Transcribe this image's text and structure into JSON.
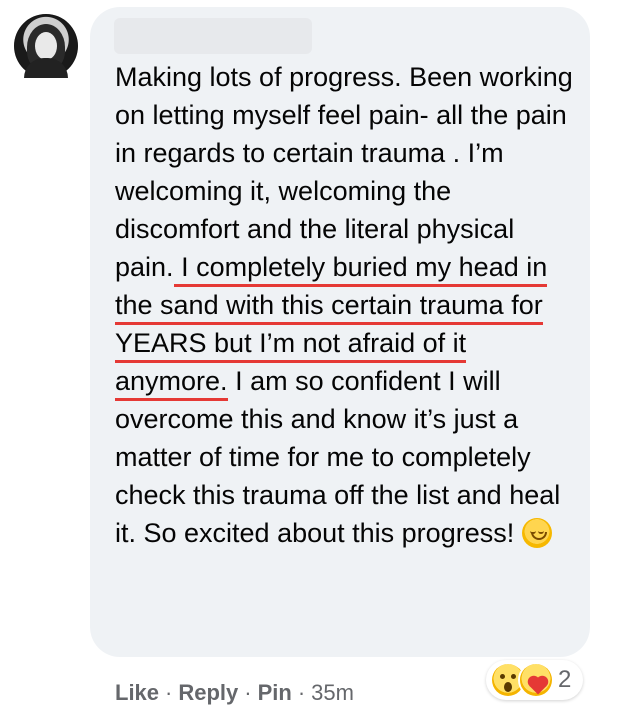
{
  "comment": {
    "text_before": "Making lots of progress. Been working on letting myself feel pain- all the pain in regards to certain trauma . I’m welcoming it, welcoming the discomfort and the literal physical pain.",
    "text_emphasized": " I completely buried my head in the sand with this certain trauma for YEARS but I’m not afraid of it anymore.",
    "text_after": " I am so confident I will overcome this and know it’s just a matter of time for me to completely check this trauma off the list and heal it. So excited about this progress!",
    "emoji": "smiling-face"
  },
  "reactions": {
    "icons": [
      "wow",
      "care"
    ],
    "count": "2"
  },
  "actions": {
    "like": "Like",
    "reply": "Reply",
    "pin": "Pin",
    "separator": "·",
    "timestamp": "35m"
  },
  "colors": {
    "bubble": "#eff2f5",
    "text": "#050505",
    "muted": "#65676b",
    "underline": "#e53935"
  }
}
